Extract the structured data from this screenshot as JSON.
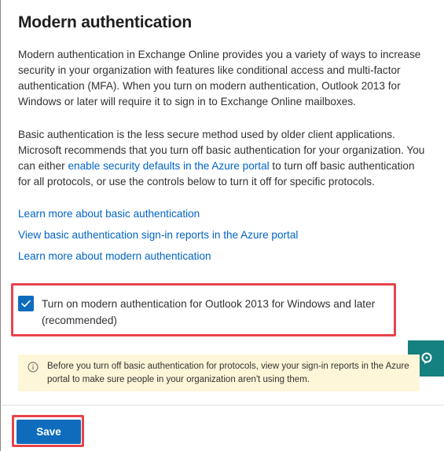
{
  "title": "Modern authentication",
  "paragraphs": {
    "intro": "Modern authentication in Exchange Online provides you a variety of ways to increase security in your organization with features like conditional access and multi-factor authentication (MFA). When you turn on modern authentication, Outlook 2013 for Windows or later will require it to sign in to Exchange Online mailboxes.",
    "basic_prefix": "Basic authentication is the less secure method used by older client applications. Microsoft recommends that you turn off basic authentication for your organization. You can either ",
    "basic_link": "enable security defaults in the Azure portal",
    "basic_suffix": " to turn off basic authentication for all protocols, or use the controls below to turn it off for specific protocols."
  },
  "links": {
    "learn_basic": "Learn more about basic authentication",
    "view_reports": "View basic authentication sign-in reports in the Azure portal",
    "learn_modern": "Learn more about modern authentication"
  },
  "checkbox": {
    "checked": true,
    "label": "Turn on modern authentication for Outlook 2013 for Windows and later (recommended)"
  },
  "warning": {
    "text": "Before you turn off basic authentication for protocols, view your sign-in reports in the Azure portal to make sure people in your organization aren't using them."
  },
  "actions": {
    "save_label": "Save"
  },
  "icons": {
    "checkmark": "checkmark-icon",
    "info": "info-icon",
    "chat": "chat-help-icon"
  },
  "colors": {
    "accent": "#0f6cbd",
    "link": "#0064c6",
    "highlight_border": "#e6434b",
    "warning_bg": "#fef6d9",
    "side_tab": "#158080"
  }
}
